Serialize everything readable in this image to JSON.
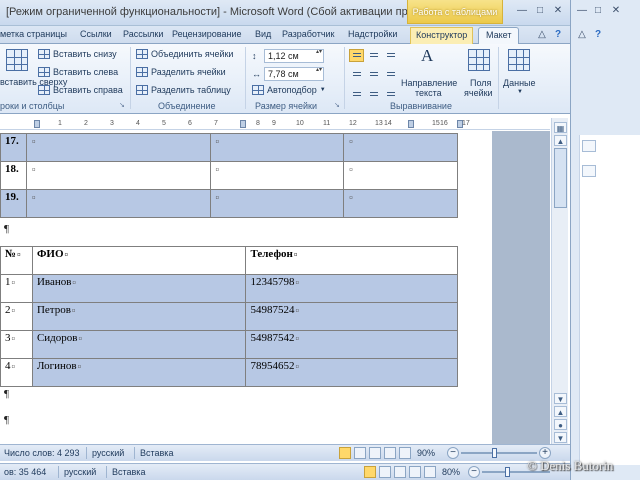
{
  "window": {
    "title": "[Режим ограниченной функциональности] - Microsoft Word (Сбой активации пр...",
    "context_tab_title": "Работа с таблицами"
  },
  "ribbon_tabs": [
    "метка страницы",
    "Ссылки",
    "Рассылки",
    "Рецензирование",
    "Вид",
    "Разработчик",
    "Надстройки",
    "Конструктор",
    "Макет"
  ],
  "ribbon": {
    "rows_cols": {
      "insert_above": "вставить сверху",
      "insert_below": "Вставить снизу",
      "insert_left": "Вставить слева",
      "insert_right": "Вставить справа",
      "label": "роки и столбцы"
    },
    "merge": {
      "merge_cells": "Объединить ячейки",
      "split_cells": "Разделить ячейки",
      "split_table": "Разделить таблицу",
      "label": "Объединение"
    },
    "cell_size": {
      "height": "1,12 см",
      "width": "7,78 см",
      "autofit": "Автоподбор",
      "label": "Размер ячейки"
    },
    "alignment": {
      "text_direction_1": "Направление",
      "text_direction_2": "текста",
      "margins_1": "Поля",
      "margins_2": "ячейки",
      "label": "Выравнивание"
    },
    "data": {
      "label": "Данные"
    }
  },
  "ruler_ticks": [
    "1",
    "2",
    "3",
    "4",
    "5",
    "6",
    "7",
    "8",
    "9",
    "10",
    "11",
    "12",
    "13",
    "14",
    "15",
    "16",
    "17"
  ],
  "table1": {
    "rows": [
      {
        "num": "17.",
        "cells": [
          "¤",
          "¤",
          "¤"
        ]
      },
      {
        "num": "18.",
        "cells": [
          "¤",
          "¤",
          "¤"
        ]
      },
      {
        "num": "19.",
        "cells": [
          "¤",
          "¤",
          "¤"
        ]
      }
    ]
  },
  "pilcrow": "¶",
  "table2": {
    "header": [
      "№",
      "ФИО",
      "Телефон"
    ],
    "rows": [
      [
        "1",
        "Иванов",
        "12345798"
      ],
      [
        "2",
        "Петров",
        "54987524"
      ],
      [
        "3",
        "Сидоров",
        "54987542"
      ],
      [
        "4",
        "Логинов",
        "78954652"
      ]
    ],
    "cell_mark": "¤"
  },
  "status_bar": {
    "words": "Число слов: 4 293",
    "language": "русский",
    "mode": "Вставка",
    "zoom": "90%",
    "zoom_value": 90
  },
  "status_bar_back": {
    "words": "ов: 35 464",
    "language": "русский",
    "mode": "Вставка",
    "zoom": "80%",
    "zoom_value": 80
  },
  "watermark": "© Denis Butorin",
  "colors": {
    "selection": "#b7c8e4",
    "ribbon": "#dde8f6",
    "context_tab": "#ecc94a"
  }
}
